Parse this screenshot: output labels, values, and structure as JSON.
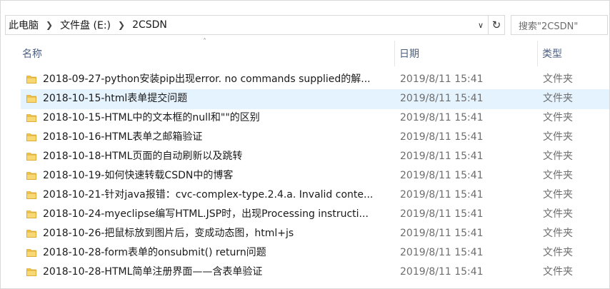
{
  "breadcrumb": [
    "此电脑",
    "文件盘 (E:)",
    "2CSDN"
  ],
  "search": {
    "placeholder": "搜索\"2CSDN\""
  },
  "columns": {
    "name": "名称",
    "date": "日期",
    "type": "类型"
  },
  "colors": {
    "folder": "#f2c94c",
    "selected_row": "#e5f3ff",
    "header_text": "#4d6082"
  },
  "files": [
    {
      "name": "2018-09-27-python安装pip出现error. no commands supplied的解...",
      "date": "2019/8/11 15:41",
      "type": "文件夹",
      "icon": "folder-icon"
    },
    {
      "name": "2018-10-15-html表单提交问题",
      "date": "2019/8/11 15:41",
      "type": "文件夹",
      "icon": "folder-icon",
      "selected": true
    },
    {
      "name": "2018-10-15-HTML中的文本框的null和\"\"的区别",
      "date": "2019/8/11 15:41",
      "type": "文件夹",
      "icon": "folder-icon"
    },
    {
      "name": "2018-10-16-HTML表单之邮箱验证",
      "date": "2019/8/11 15:41",
      "type": "文件夹",
      "icon": "folder-icon"
    },
    {
      "name": "2018-10-18-HTML页面的自动刷新以及跳转",
      "date": "2019/8/11 15:41",
      "type": "文件夹",
      "icon": "folder-icon"
    },
    {
      "name": "2018-10-19-如何快速转载CSDN中的博客",
      "date": "2019/8/11 15:41",
      "type": "文件夹",
      "icon": "folder-icon"
    },
    {
      "name": "2018-10-21-针对java报错：cvc-complex-type.2.4.a. Invalid conte...",
      "date": "2019/8/11 15:41",
      "type": "文件夹",
      "icon": "folder-icon"
    },
    {
      "name": "2018-10-24-myeclipse编写HTML.JSP时，出现Processing instructi...",
      "date": "2019/8/11 15:41",
      "type": "文件夹",
      "icon": "folder-icon"
    },
    {
      "name": "2018-10-26-把鼠标放到图片后，变成动态图，html+js",
      "date": "2019/8/11 15:41",
      "type": "文件夹",
      "icon": "folder-icon"
    },
    {
      "name": "2018-10-28-form表单的onsubmit() return问题",
      "date": "2019/8/11 15:41",
      "type": "文件夹",
      "icon": "folder-icon"
    },
    {
      "name": "2018-10-28-HTML简单注册界面——含表单验证",
      "date": "2019/8/11 15:41",
      "type": "文件夹",
      "icon": "folder-icon"
    }
  ]
}
